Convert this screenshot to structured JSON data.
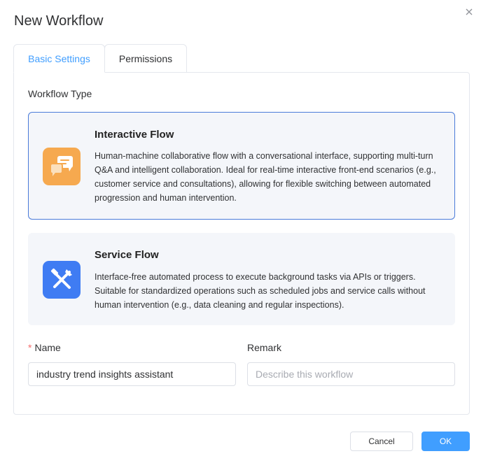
{
  "dialog": {
    "title": "New Workflow"
  },
  "tabs": [
    {
      "label": "Basic Settings",
      "active": true
    },
    {
      "label": "Permissions",
      "active": false
    }
  ],
  "workflow_type": {
    "label": "Workflow Type",
    "options": [
      {
        "title": "Interactive Flow",
        "description": "Human-machine collaborative flow with a conversational interface, supporting multi-turn Q&A and intelligent collaboration. Ideal for real-time interactive front-end scenarios (e.g., customer service and consultations), allowing for flexible switching between automated progression and human intervention.",
        "icon": "chat-bubbles-icon",
        "icon_color": "#f6a94f",
        "selected": true
      },
      {
        "title": "Service Flow",
        "description": "Interface-free automated process to execute background tasks via APIs or triggers. Suitable for standardized operations such as scheduled jobs and service calls without human intervention (e.g., data cleaning and regular inspections).",
        "icon": "tools-icon",
        "icon_color": "#3f7cf3",
        "selected": false
      }
    ]
  },
  "form": {
    "name": {
      "label": "Name",
      "required_marker": "*",
      "value": "industry trend insights assistant"
    },
    "remark": {
      "label": "Remark",
      "placeholder": "Describe this workflow",
      "value": ""
    }
  },
  "footer": {
    "cancel_label": "Cancel",
    "ok_label": "OK"
  },
  "colors": {
    "accent": "#409eff",
    "selected_border": "#4a7bd9",
    "required": "#f56c6c"
  }
}
